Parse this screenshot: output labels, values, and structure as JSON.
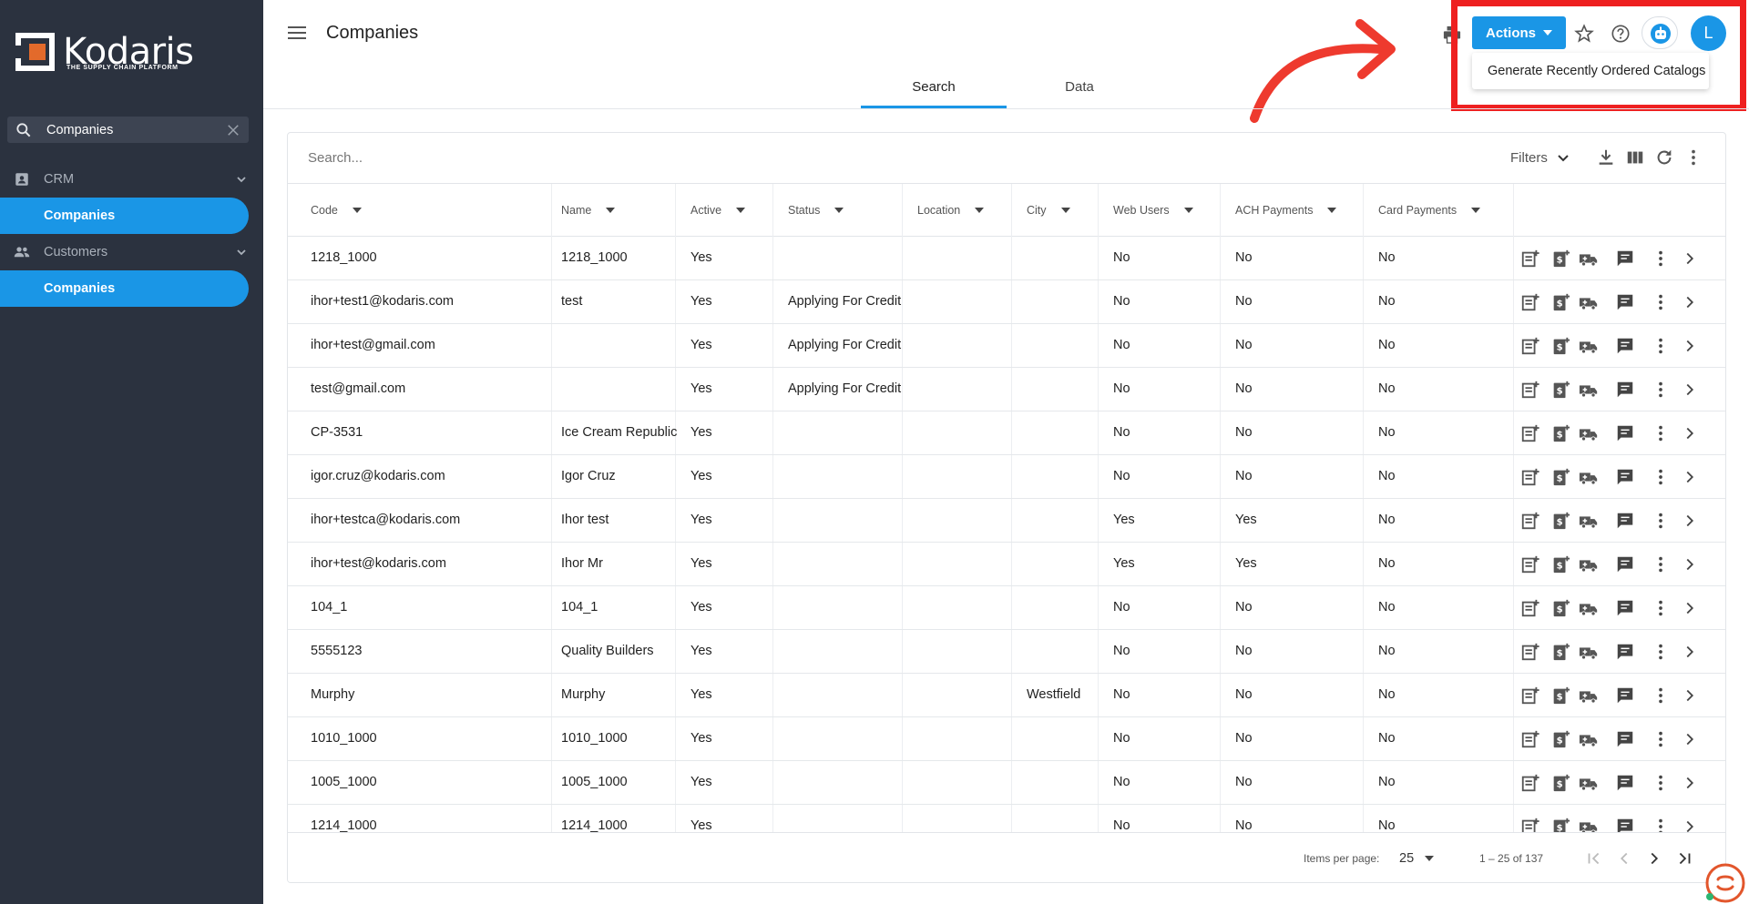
{
  "app": {
    "logo_text": "Kodaris",
    "logo_tagline": "THE SUPPLY CHAIN PLATFORM",
    "accent_color": "#1a96e6",
    "sidebar_bg": "#2b323f"
  },
  "sidebar": {
    "search_value": "Companies",
    "groups": [
      {
        "label": "CRM",
        "icon": "contact-card-icon",
        "item": "Companies"
      },
      {
        "label": "Customers",
        "icon": "people-icon",
        "item": "Companies"
      }
    ]
  },
  "header": {
    "title": "Companies",
    "actions_label": "Actions",
    "avatar_initial": "L"
  },
  "actions_menu": {
    "items": [
      "Generate Recently Ordered Catalogs"
    ]
  },
  "tabs": [
    "Search",
    "Data"
  ],
  "table": {
    "search_placeholder": "Search...",
    "filters_label": "Filters",
    "columns": [
      "Code",
      "Name",
      "Active",
      "Status",
      "Location",
      "City",
      "Web Users",
      "ACH Payments",
      "Card Payments"
    ],
    "rows": [
      [
        "1218_1000",
        "1218_1000",
        "Yes",
        "",
        "",
        "",
        "No",
        "No",
        "No"
      ],
      [
        "ihor+test1@kodaris.com",
        "test",
        "Yes",
        "Applying For Credit",
        "",
        "",
        "No",
        "No",
        "No"
      ],
      [
        "ihor+test@gmail.com",
        "",
        "Yes",
        "Applying For Credit",
        "",
        "",
        "No",
        "No",
        "No"
      ],
      [
        "test@gmail.com",
        "",
        "Yes",
        "Applying For Credit",
        "",
        "",
        "No",
        "No",
        "No"
      ],
      [
        "CP-3531",
        "Ice Cream Republic",
        "Yes",
        "",
        "",
        "",
        "No",
        "No",
        "No"
      ],
      [
        "igor.cruz@kodaris.com",
        "Igor Cruz",
        "Yes",
        "",
        "",
        "",
        "No",
        "No",
        "No"
      ],
      [
        "ihor+testca@kodaris.com",
        "Ihor test",
        "Yes",
        "",
        "",
        "",
        "Yes",
        "Yes",
        "No"
      ],
      [
        "ihor+test@kodaris.com",
        "Ihor Mr",
        "Yes",
        "",
        "",
        "",
        "Yes",
        "Yes",
        "No"
      ],
      [
        "104_1",
        "104_1",
        "Yes",
        "",
        "",
        "",
        "No",
        "No",
        "No"
      ],
      [
        "5555123",
        "Quality Builders",
        "Yes",
        "",
        "",
        "",
        "No",
        "No",
        "No"
      ],
      [
        "Murphy",
        "Murphy",
        "Yes",
        "",
        "",
        "Westfield",
        "No",
        "No",
        "No"
      ],
      [
        "1010_1000",
        "1010_1000",
        "Yes",
        "",
        "",
        "",
        "No",
        "No",
        "No"
      ],
      [
        "1005_1000",
        "1005_1000",
        "Yes",
        "",
        "",
        "",
        "No",
        "No",
        "No"
      ],
      [
        "1214_1000",
        "1214_1000",
        "Yes",
        "",
        "",
        "",
        "No",
        "No",
        "No"
      ]
    ],
    "row_actions": [
      "add-note-icon",
      "price-icon",
      "shipping-truck-icon",
      "comment-icon",
      "more-vert-icon",
      "chevron-right-icon"
    ]
  },
  "paginator": {
    "items_per_page_label": "Items per page:",
    "page_size": "25",
    "range_label": "1 – 25 of 137"
  }
}
